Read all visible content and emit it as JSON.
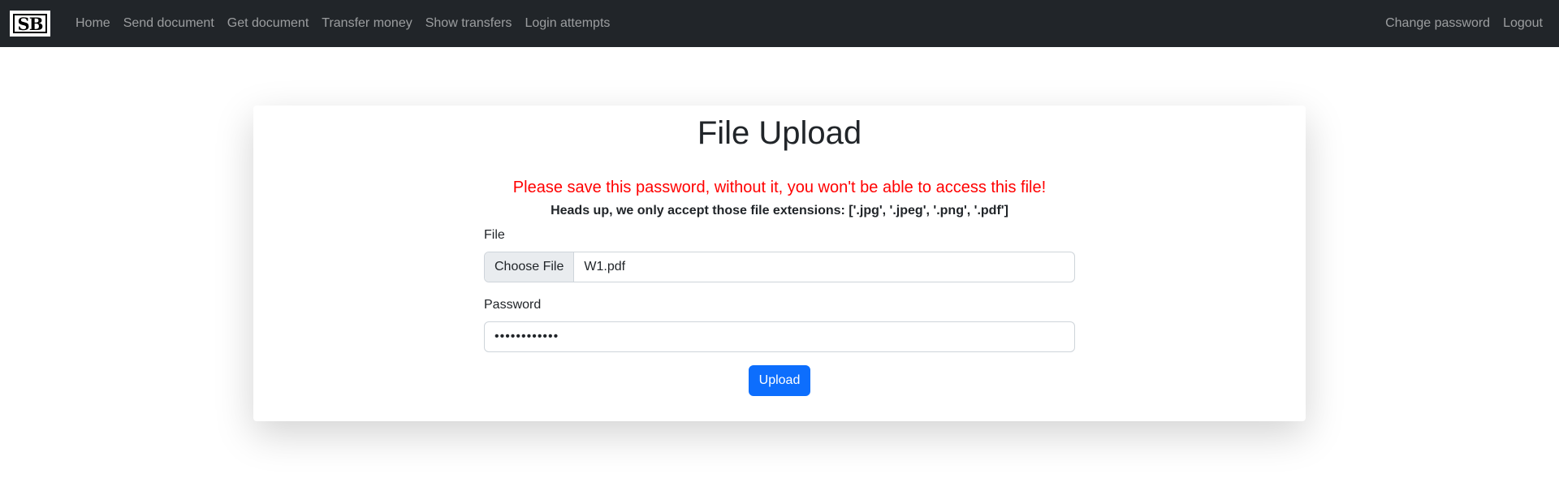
{
  "navbar": {
    "brand_text": "SB",
    "left_links": [
      "Home",
      "Send document",
      "Get document",
      "Transfer money",
      "Show transfers",
      "Login attempts"
    ],
    "right_links": [
      "Change password",
      "Logout"
    ],
    "background": "#212529"
  },
  "page": {
    "title": "File Upload",
    "warning": "Please save this password, without it, you won't be able to access this file!",
    "warning_color": "#ff0000",
    "headsup": "Heads up, we only accept those file extensions: ['.jpg', '.jpeg', '.png', '.pdf']"
  },
  "form": {
    "file_label": "File",
    "file_button": "Choose File",
    "file_value": "W1.pdf",
    "password_label": "Password",
    "password_value": "••••••••••••",
    "submit_label": "Upload",
    "submit_color": "#0d6efd"
  }
}
